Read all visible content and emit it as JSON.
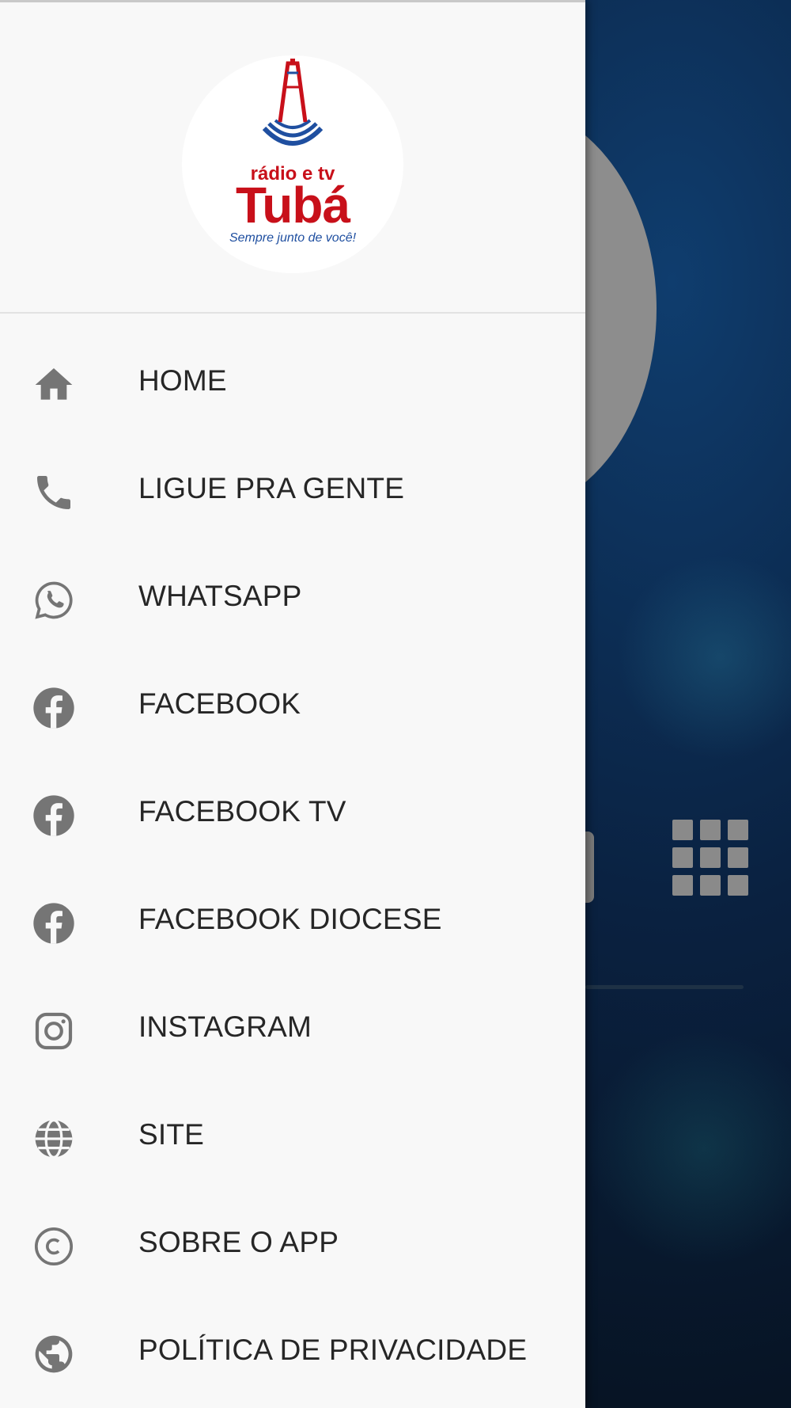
{
  "colors": {
    "drawer_bg": "#f8f8f8",
    "icon": "#757575",
    "label": "#262626",
    "brand_red": "#c8101a",
    "brand_blue": "#1f4fa0"
  },
  "logo": {
    "top_text": "rádio e tv",
    "main_text": "Tubá",
    "tagline": "Sempre junto de você!"
  },
  "menu": {
    "items": [
      {
        "label": "HOME",
        "icon": "home-icon"
      },
      {
        "label": "LIGUE PRA GENTE",
        "icon": "phone-icon"
      },
      {
        "label": "WHATSAPP",
        "icon": "whatsapp-icon"
      },
      {
        "label": "FACEBOOK",
        "icon": "facebook-icon"
      },
      {
        "label": "FACEBOOK TV",
        "icon": "facebook-icon"
      },
      {
        "label": "FACEBOOK DIOCESE",
        "icon": "facebook-icon"
      },
      {
        "label": "INSTAGRAM",
        "icon": "instagram-icon"
      },
      {
        "label": "SITE",
        "icon": "globe-icon"
      },
      {
        "label": "SOBRE O APP",
        "icon": "copyright-icon"
      },
      {
        "label": "POLÍTICA DE PRIVACIDADE",
        "icon": "public-globe-icon"
      }
    ]
  }
}
